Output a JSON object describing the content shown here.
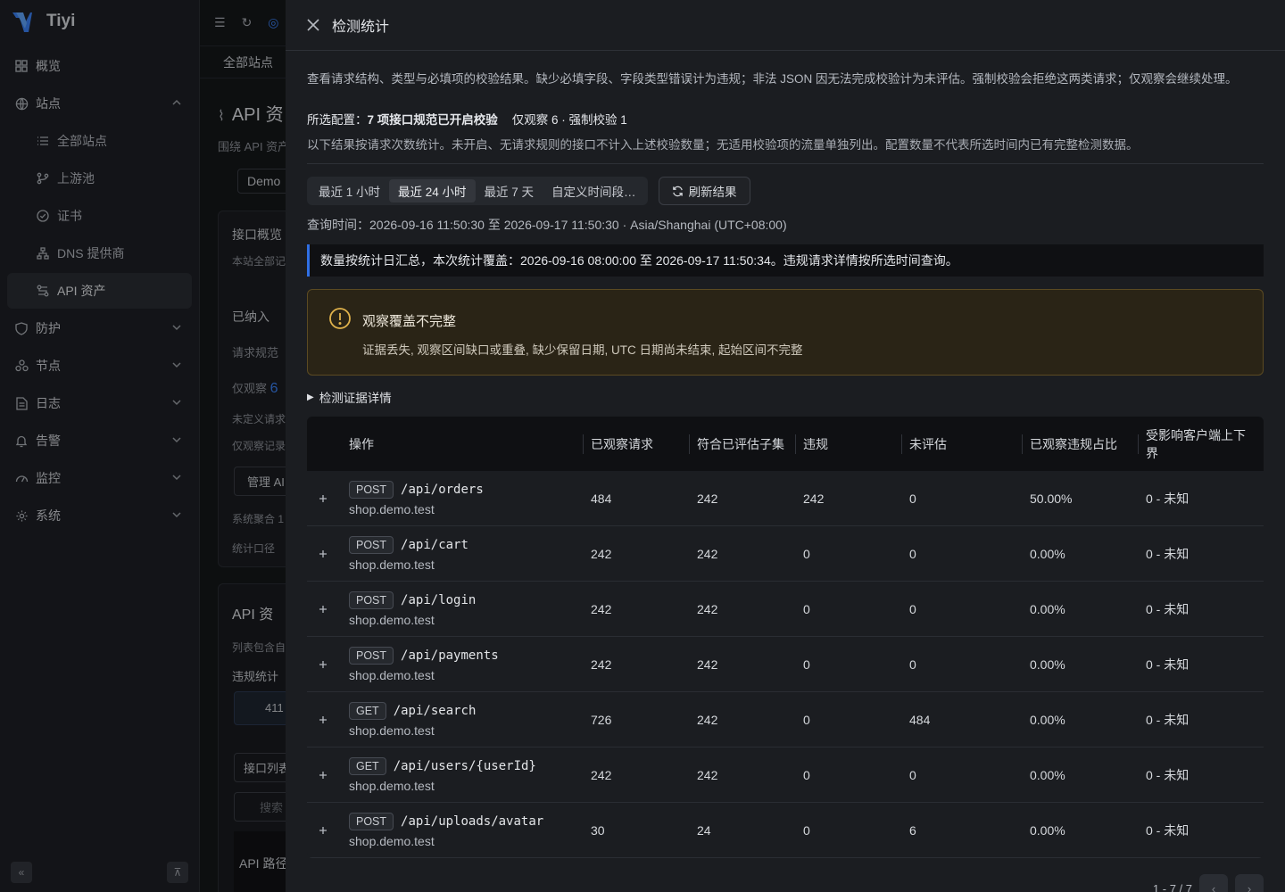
{
  "app": {
    "name": "Tiyi"
  },
  "sidebar": {
    "items": [
      {
        "label": "概览",
        "icon": "dashboard-icon"
      },
      {
        "label": "站点",
        "icon": "globe-icon"
      },
      {
        "label": "全部站点",
        "icon": "list-icon"
      },
      {
        "label": "上游池",
        "icon": "branch-icon"
      },
      {
        "label": "证书",
        "icon": "check-circle-icon"
      },
      {
        "label": "DNS 提供商",
        "icon": "network-icon"
      },
      {
        "label": "API 资产",
        "icon": "api-icon"
      },
      {
        "label": "防护",
        "icon": "shield-icon"
      },
      {
        "label": "节点",
        "icon": "nodes-icon"
      },
      {
        "label": "日志",
        "icon": "file-icon"
      },
      {
        "label": "告警",
        "icon": "bell-icon"
      },
      {
        "label": "监控",
        "icon": "gauge-icon"
      },
      {
        "label": "系统",
        "icon": "gear-icon"
      }
    ]
  },
  "background": {
    "tab": "全部站点",
    "title": "API 资",
    "subtitle": "围绕 API 资产",
    "demo": "Demo",
    "card_title": "接口概览",
    "card_sub": "本站全部记",
    "included": "已纳入",
    "rules": "请求规范",
    "observe": "仅观察",
    "observe_num": "6",
    "undefined_req": "未定义请求",
    "observe_only": "仅观察记录",
    "manage": "管理 AI",
    "aggregate": "系统聚合 1",
    "stat_port": "统计口径",
    "api_section": "API 资",
    "list_note": "列表包含自",
    "violation_stat": "违规统计",
    "count_411": "411",
    "api_list": "接口列表",
    "search": "搜索",
    "api_path": "API 路径"
  },
  "drawer": {
    "title": "检测统计",
    "description": "查看请求结构、类型与必填项的校验结果。缺少必填字段、字段类型错误计为违规；非法 JSON 因无法完成校验计为未评估。强制校验会拒绝这两类请求；仅观察会继续处理。",
    "config_label": "所选配置：",
    "config_value": "7 项接口规范已开启校验",
    "config_breakdown": "仅观察 6 · 强制校验 1",
    "config_note": "以下结果按请求次数统计。未开启、无请求规则的接口不计入上述校验数量；无适用校验项的流量单独列出。配置数量不代表所选时间内已有完整检测数据。",
    "ranges": [
      "最近 1 小时",
      "最近 24 小时",
      "最近 7 天",
      "自定义时间段…"
    ],
    "refresh": "刷新结果",
    "query_time": "查询时间：2026-09-16 11:50:30 至 2026-09-17 11:50:30 · Asia/Shanghai (UTC+08:00)",
    "info": "数量按统计日汇总，本次统计覆盖：2026-09-16 08:00:00 至 2026-09-17 11:50:34。违规请求详情按所选时间查询。",
    "warning_title": "观察覆盖不完整",
    "warning_text": "证据丢失, 观察区间缺口或重叠, 缺少保留日期, UTC 日期尚未结束, 起始区间不完整",
    "details_label": "检测证据详情",
    "table": {
      "headers": [
        "操作",
        "已观察请求",
        "符合已评估子集",
        "违规",
        "未评估",
        "已观察违规占比",
        "受影响客户端上下界"
      ],
      "rows": [
        {
          "method": "POST",
          "path": "/api/orders",
          "host": "shop.demo.test",
          "observed": "484",
          "compliant": "242",
          "violations": "242",
          "unevaluated": "0",
          "ratio": "50.00%",
          "clients": "0 - 未知"
        },
        {
          "method": "POST",
          "path": "/api/cart",
          "host": "shop.demo.test",
          "observed": "242",
          "compliant": "242",
          "violations": "0",
          "unevaluated": "0",
          "ratio": "0.00%",
          "clients": "0 - 未知"
        },
        {
          "method": "POST",
          "path": "/api/login",
          "host": "shop.demo.test",
          "observed": "242",
          "compliant": "242",
          "violations": "0",
          "unevaluated": "0",
          "ratio": "0.00%",
          "clients": "0 - 未知"
        },
        {
          "method": "POST",
          "path": "/api/payments",
          "host": "shop.demo.test",
          "observed": "242",
          "compliant": "242",
          "violations": "0",
          "unevaluated": "0",
          "ratio": "0.00%",
          "clients": "0 - 未知"
        },
        {
          "method": "GET",
          "path": "/api/search",
          "host": "shop.demo.test",
          "observed": "726",
          "compliant": "242",
          "violations": "0",
          "unevaluated": "484",
          "ratio": "0.00%",
          "clients": "0 - 未知"
        },
        {
          "method": "GET",
          "path": "/api/users/{userId}",
          "host": "shop.demo.test",
          "observed": "242",
          "compliant": "242",
          "violations": "0",
          "unevaluated": "0",
          "ratio": "0.00%",
          "clients": "0 - 未知"
        },
        {
          "method": "POST",
          "path": "/api/uploads/avatar",
          "host": "shop.demo.test",
          "observed": "30",
          "compliant": "24",
          "violations": "0",
          "unevaluated": "6",
          "ratio": "0.00%",
          "clients": "0 - 未知"
        }
      ]
    },
    "pagination": "1 - 7 / 7"
  },
  "colors": {
    "accent": "#2f6fe4",
    "warning": "#e0b24b",
    "brand": "#4a90e2"
  }
}
